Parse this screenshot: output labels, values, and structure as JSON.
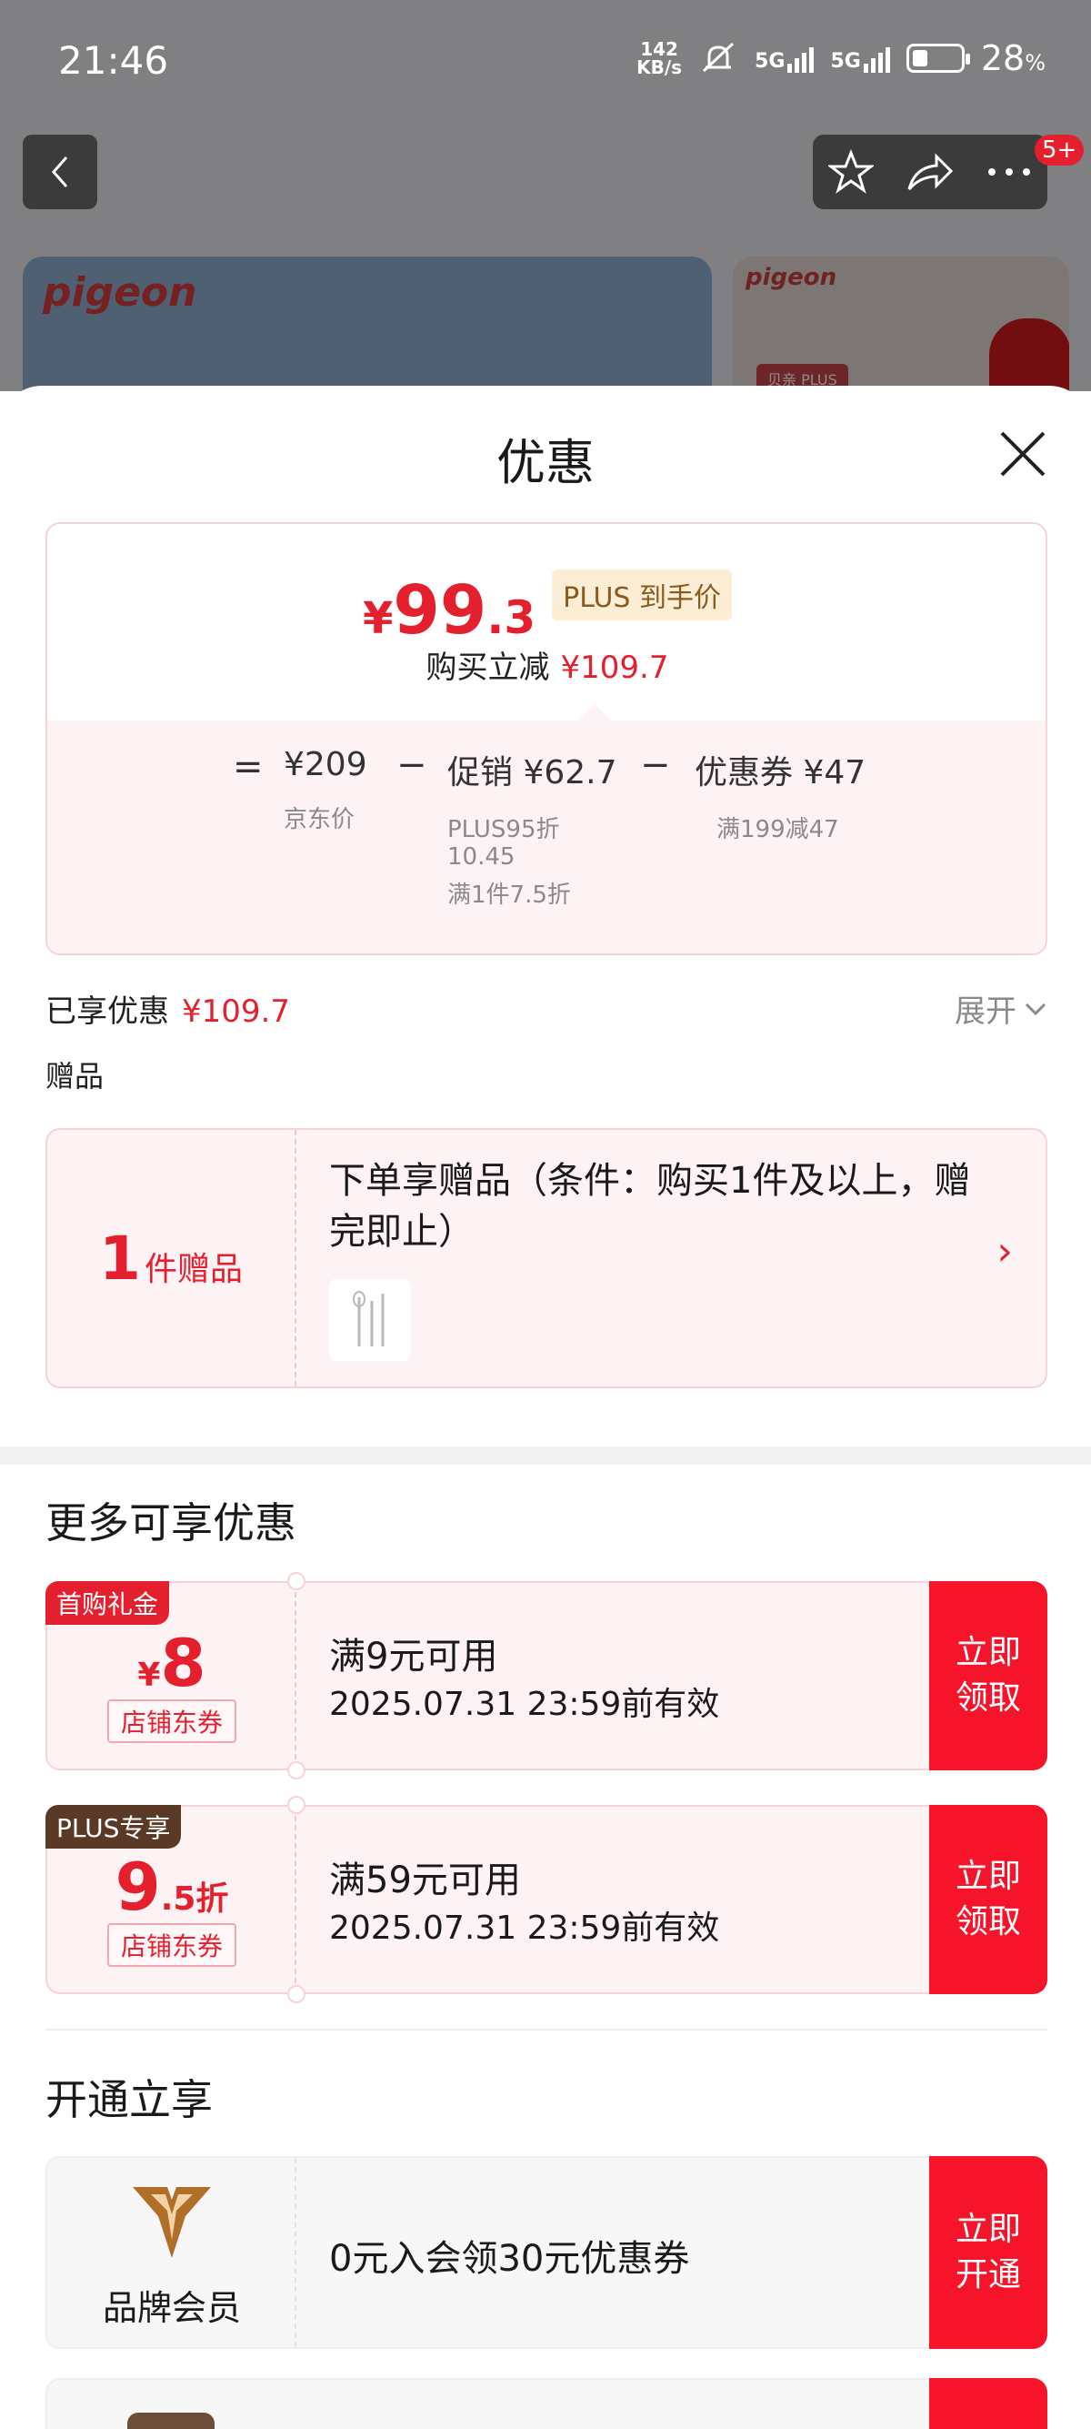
{
  "status": {
    "time": "21:46",
    "speed_value": "142",
    "speed_unit": "KB/s",
    "sig1": "5G",
    "sig2": "5G",
    "battery_value": "28",
    "battery_unit": "%"
  },
  "topbar": {
    "badge": "5+"
  },
  "background": {
    "brand": "pigeon",
    "side_brand": "pigeon",
    "side_tag": "贝亲 PLUS"
  },
  "sheet": {
    "title": "优惠"
  },
  "price": {
    "currency": "¥",
    "final_int": "99",
    "final_dec": ".3",
    "plus_tag": "PLUS 到手价",
    "reduce_label": "购买立减",
    "reduce_value": "¥109.7"
  },
  "breakdown": {
    "eq": "=",
    "minus": "−",
    "jd_price": "¥209",
    "jd_label": "京东价",
    "promo": "促销 ¥62.7",
    "promo_sub1": "PLUS95折",
    "promo_sub2": "10.45",
    "promo_sub3": "满1件7.5折",
    "coupon": "优惠券 ¥47",
    "coupon_sub": "满199减47"
  },
  "enjoyed": {
    "label": "已享优惠",
    "value": "¥109.7",
    "expand": "展开"
  },
  "gift": {
    "heading": "赠品",
    "count": "1",
    "count_label": "件赠品",
    "desc": "下单享赠品（条件：购买1件及以上，赠完即止）",
    "arrow": "›"
  },
  "more": {
    "title": "更多可享优惠",
    "coupons": [
      {
        "tag": "首购礼金",
        "value_prefix": "¥",
        "value_main": "8",
        "value_suffix": "",
        "store": "店铺东券",
        "condition": "满9元可用",
        "expiry": "2025.07.31 23:59前有效",
        "button_line1": "立即",
        "button_line2": "领取"
      },
      {
        "tag": "PLUS专享",
        "value_prefix": "",
        "value_main": "9",
        "value_suffix": ".5折",
        "store": "店铺东券",
        "condition": "满59元可用",
        "expiry": "2025.07.31 23:59前有效",
        "button_line1": "立即",
        "button_line2": "领取"
      }
    ]
  },
  "open": {
    "title": "开通立享",
    "member_label": "品牌会员",
    "member_text": "0元入会领30元优惠券",
    "button_line1": "立即",
    "button_line2": "开通"
  }
}
